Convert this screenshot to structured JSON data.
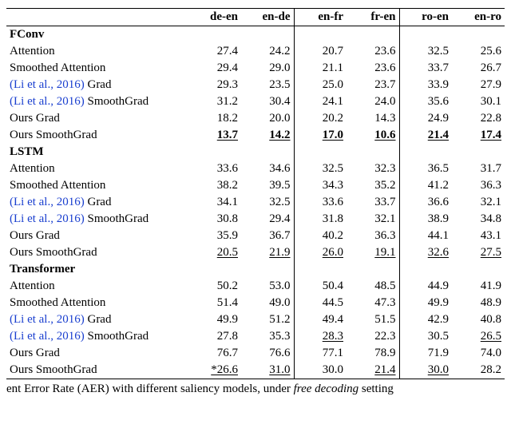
{
  "chart_data": {
    "type": "table",
    "columns": [
      "de-en",
      "en-de",
      "en-fr",
      "fr-en",
      "ro-en",
      "en-ro"
    ],
    "groups": [
      [
        "de-en",
        "en-de"
      ],
      [
        "en-fr",
        "fr-en"
      ],
      [
        "ro-en",
        "en-ro"
      ]
    ],
    "sections": [
      {
        "name": "FConv",
        "rows": [
          {
            "label": "Attention",
            "cite": false,
            "vals": [
              {
                "v": "27.4"
              },
              {
                "v": "24.2"
              },
              {
                "v": "20.7"
              },
              {
                "v": "23.6"
              },
              {
                "v": "32.5"
              },
              {
                "v": "25.6"
              }
            ]
          },
          {
            "label": "Smoothed Attention",
            "cite": false,
            "vals": [
              {
                "v": "29.4"
              },
              {
                "v": "29.0"
              },
              {
                "v": "21.1"
              },
              {
                "v": "23.6"
              },
              {
                "v": "33.7"
              },
              {
                "v": "26.7"
              }
            ]
          },
          {
            "label_prefix": "(Li et al., 2016)",
            "label_suffix": " Grad",
            "cite": true,
            "vals": [
              {
                "v": "29.3"
              },
              {
                "v": "23.5"
              },
              {
                "v": "25.0"
              },
              {
                "v": "23.7"
              },
              {
                "v": "33.9"
              },
              {
                "v": "27.9"
              }
            ]
          },
          {
            "label_prefix": "(Li et al., 2016)",
            "label_suffix": " SmoothGrad",
            "cite": true,
            "vals": [
              {
                "v": "31.2"
              },
              {
                "v": "30.4"
              },
              {
                "v": "24.1"
              },
              {
                "v": "24.0"
              },
              {
                "v": "35.6"
              },
              {
                "v": "30.1"
              }
            ]
          },
          {
            "label": "Ours Grad",
            "cite": false,
            "vals": [
              {
                "v": "18.2"
              },
              {
                "v": "20.0"
              },
              {
                "v": "20.2"
              },
              {
                "v": "14.3"
              },
              {
                "v": "24.9"
              },
              {
                "v": "22.8"
              }
            ]
          },
          {
            "label": "Ours SmoothGrad",
            "cite": false,
            "vals": [
              {
                "v": "13.7",
                "b": true,
                "u": true
              },
              {
                "v": "14.2",
                "b": true,
                "u": true
              },
              {
                "v": "17.0",
                "b": true,
                "u": true
              },
              {
                "v": "10.6",
                "b": true,
                "u": true
              },
              {
                "v": "21.4",
                "b": true,
                "u": true
              },
              {
                "v": "17.4",
                "b": true,
                "u": true
              }
            ]
          }
        ]
      },
      {
        "name": "LSTM",
        "rows": [
          {
            "label": "Attention",
            "cite": false,
            "vals": [
              {
                "v": "33.6"
              },
              {
                "v": "34.6"
              },
              {
                "v": "32.5"
              },
              {
                "v": "32.3"
              },
              {
                "v": "36.5"
              },
              {
                "v": "31.7"
              }
            ]
          },
          {
            "label": "Smoothed Attention",
            "cite": false,
            "vals": [
              {
                "v": "38.2"
              },
              {
                "v": "39.5"
              },
              {
                "v": "34.3"
              },
              {
                "v": "35.2"
              },
              {
                "v": "41.2"
              },
              {
                "v": "36.3"
              }
            ]
          },
          {
            "label_prefix": "(Li et al., 2016)",
            "label_suffix": " Grad",
            "cite": true,
            "vals": [
              {
                "v": "34.1"
              },
              {
                "v": "32.5"
              },
              {
                "v": "33.6"
              },
              {
                "v": "33.7"
              },
              {
                "v": "36.6"
              },
              {
                "v": "32.1"
              }
            ]
          },
          {
            "label_prefix": "(Li et al., 2016)",
            "label_suffix": " SmoothGrad",
            "cite": true,
            "vals": [
              {
                "v": "30.8"
              },
              {
                "v": "29.4"
              },
              {
                "v": "31.8"
              },
              {
                "v": "32.1"
              },
              {
                "v": "38.9"
              },
              {
                "v": "34.8"
              }
            ]
          },
          {
            "label": "Ours Grad",
            "cite": false,
            "vals": [
              {
                "v": "35.9"
              },
              {
                "v": "36.7"
              },
              {
                "v": "40.2"
              },
              {
                "v": "36.3"
              },
              {
                "v": "44.1"
              },
              {
                "v": "43.1"
              }
            ]
          },
          {
            "label": "Ours SmoothGrad",
            "cite": false,
            "vals": [
              {
                "v": "20.5",
                "u": true
              },
              {
                "v": "21.9",
                "u": true
              },
              {
                "v": "26.0",
                "u": true
              },
              {
                "v": "19.1",
                "u": true
              },
              {
                "v": "32.6",
                "u": true
              },
              {
                "v": "27.5",
                "u": true
              }
            ]
          }
        ]
      },
      {
        "name": "Transformer",
        "rows": [
          {
            "label": "Attention",
            "cite": false,
            "vals": [
              {
                "v": "50.2"
              },
              {
                "v": "53.0"
              },
              {
                "v": "50.4"
              },
              {
                "v": "48.5"
              },
              {
                "v": "44.9"
              },
              {
                "v": "41.9"
              }
            ]
          },
          {
            "label": "Smoothed Attention",
            "cite": false,
            "vals": [
              {
                "v": "51.4"
              },
              {
                "v": "49.0"
              },
              {
                "v": "44.5"
              },
              {
                "v": "47.3"
              },
              {
                "v": "49.9"
              },
              {
                "v": "48.9"
              }
            ]
          },
          {
            "label_prefix": "(Li et al., 2016)",
            "label_suffix": " Grad",
            "cite": true,
            "vals": [
              {
                "v": "49.9"
              },
              {
                "v": "51.2"
              },
              {
                "v": "49.4"
              },
              {
                "v": "51.5"
              },
              {
                "v": "42.9"
              },
              {
                "v": "40.8"
              }
            ]
          },
          {
            "label_prefix": "(Li et al., 2016)",
            "label_suffix": " SmoothGrad",
            "cite": true,
            "vals": [
              {
                "v": "27.8"
              },
              {
                "v": "35.3"
              },
              {
                "v": "28.3",
                "u": true
              },
              {
                "v": "22.3"
              },
              {
                "v": "30.5"
              },
              {
                "v": "26.5",
                "u": true
              }
            ]
          },
          {
            "label": "Ours Grad",
            "cite": false,
            "vals": [
              {
                "v": "76.7"
              },
              {
                "v": "76.6"
              },
              {
                "v": "77.1"
              },
              {
                "v": "78.9"
              },
              {
                "v": "71.9"
              },
              {
                "v": "74.0"
              }
            ]
          },
          {
            "label": "Ours SmoothGrad",
            "cite": false,
            "vals": [
              {
                "v": "*26.6",
                "u": true
              },
              {
                "v": "31.0",
                "u": true
              },
              {
                "v": "30.0"
              },
              {
                "v": "21.4",
                "u": true
              },
              {
                "v": "30.0",
                "u": true
              },
              {
                "v": "28.2"
              }
            ]
          }
        ]
      }
    ]
  },
  "caption_parts": {
    "p1": "ent Error Rate (AER) with different saliency models, under ",
    "p2": "free decoding",
    "p3": " setting"
  }
}
